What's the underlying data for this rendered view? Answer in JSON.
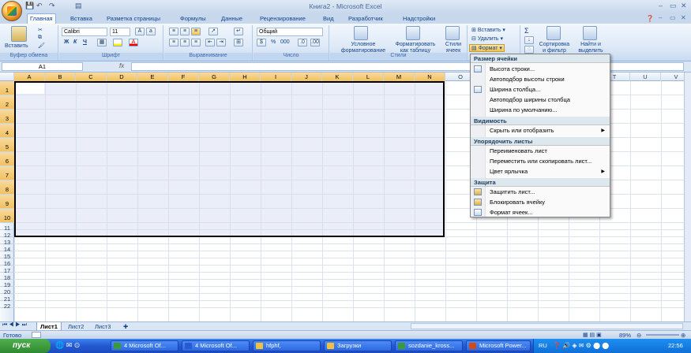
{
  "window": {
    "title": "Книга2 - Microsoft Excel",
    "controls": {
      "minimize": "–",
      "restore": "▭",
      "close": "✕"
    }
  },
  "quick_access": {
    "icons": [
      "save-icon",
      "undo-icon",
      "redo-icon",
      "print-preview-icon"
    ]
  },
  "tabs": [
    {
      "label": "Главная",
      "active": true
    },
    {
      "label": "Вставка"
    },
    {
      "label": "Разметка страницы"
    },
    {
      "label": "Формулы"
    },
    {
      "label": "Данные"
    },
    {
      "label": "Рецензирование"
    },
    {
      "label": "Вид"
    },
    {
      "label": "Разработчик"
    },
    {
      "label": "Надстройки"
    }
  ],
  "ribbon": {
    "clipboard": {
      "paste": "Вставить",
      "label": "Буфер обмена"
    },
    "font": {
      "name": "Calibri",
      "size": "11",
      "label": "Шрифт",
      "bold": "Ж",
      "italic": "К",
      "underline": "Ч"
    },
    "alignment": {
      "label": "Выравнивание"
    },
    "number": {
      "format": "Общий",
      "label": "Число",
      "percent": "%",
      "thousands": "000"
    },
    "styles": {
      "conditional": "Условное форматирование",
      "as_table": "Форматировать как таблицу",
      "cell_styles": "Стили ячеек",
      "label": "Стили"
    },
    "cells": {
      "insert": "Вставить",
      "delete": "Удалить",
      "format": "Формат"
    },
    "editing": {
      "sort": "Сортировка и фильтр",
      "find": "Найти и выделить",
      "sigma": "Σ"
    }
  },
  "formula_bar": {
    "name_box": "A1",
    "fx": "fx",
    "value": ""
  },
  "columns": [
    "A",
    "B",
    "C",
    "D",
    "E",
    "F",
    "G",
    "H",
    "I",
    "J",
    "K",
    "L",
    "M",
    "N",
    "O",
    "P",
    "Q",
    "R",
    "S",
    "T",
    "U",
    "V"
  ],
  "rows": [
    "1",
    "2",
    "3",
    "4",
    "5",
    "6",
    "7",
    "8",
    "9",
    "10",
    "11",
    "12",
    "13",
    "14",
    "15",
    "16",
    "17",
    "18",
    "19",
    "20",
    "21",
    "22"
  ],
  "format_menu": {
    "section_size": "Размер ячейки",
    "row_height": "Высота строки...",
    "autofit_row": "Автоподбор высоты строки",
    "col_width": "Ширина столбца...",
    "autofit_col": "Автоподбор ширины столбца",
    "default_width": "Ширина по умолчанию...",
    "section_visibility": "Видимость",
    "hide_show": "Скрыть или отобразить",
    "section_sheets": "Упорядочить листы",
    "rename": "Переименовать лист",
    "move_copy": "Переместить или скопировать лист...",
    "tab_color": "Цвет ярлычка",
    "section_protect": "Защита",
    "protect_sheet": "Защитить лист...",
    "lock_cell": "Блокировать ячейку",
    "format_cells": "Формат ячеек..."
  },
  "sheets": {
    "tabs": [
      "Лист1",
      "Лист2",
      "Лист3"
    ],
    "active": "Лист1"
  },
  "status": {
    "ready": "Готово",
    "zoom": "89%"
  },
  "taskbar": {
    "start": "пуск",
    "items": [
      "4 Microsoft Of...",
      "4 Microsoft Of...",
      "hfphf,",
      "Загрузки",
      "sozdanie_kross...",
      "Microsoft Power..."
    ],
    "lang": "RU",
    "clock": "22:56"
  },
  "colors": {
    "accent": "#15428b",
    "selection": "#f1c15f",
    "taskbar": "#2459d1",
    "start": "#2f8a2f"
  }
}
